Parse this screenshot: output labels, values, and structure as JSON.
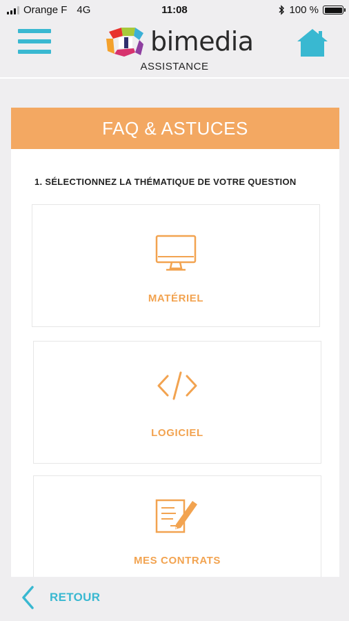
{
  "status_bar": {
    "carrier": "Orange F",
    "network": "4G",
    "time": "11:08",
    "battery": "100 %",
    "icons": [
      "signal-icon",
      "bluetooth-icon",
      "battery-icon"
    ]
  },
  "header": {
    "logo_text": "bimedia",
    "subtitle": "ASSISTANCE",
    "menu_icon": "hamburger-menu-icon",
    "home_icon": "home-icon",
    "accent_color": "#39b8d1"
  },
  "card": {
    "title": "FAQ & ASTUCES",
    "title_color": "#f3a862",
    "instruction": "1. SÉLECTIONNEZ LA THÉMATIQUE DE VOTRE QUESTION",
    "themes": [
      {
        "label": "MATÉRIEL",
        "icon": "monitor-icon"
      },
      {
        "label": "LOGICIEL",
        "icon": "code-icon"
      },
      {
        "label": "MES CONTRATS",
        "icon": "contract-edit-icon"
      }
    ],
    "accent_color": "#f2a350"
  },
  "footer": {
    "back_label": "RETOUR",
    "back_icon": "chevron-left-icon"
  }
}
